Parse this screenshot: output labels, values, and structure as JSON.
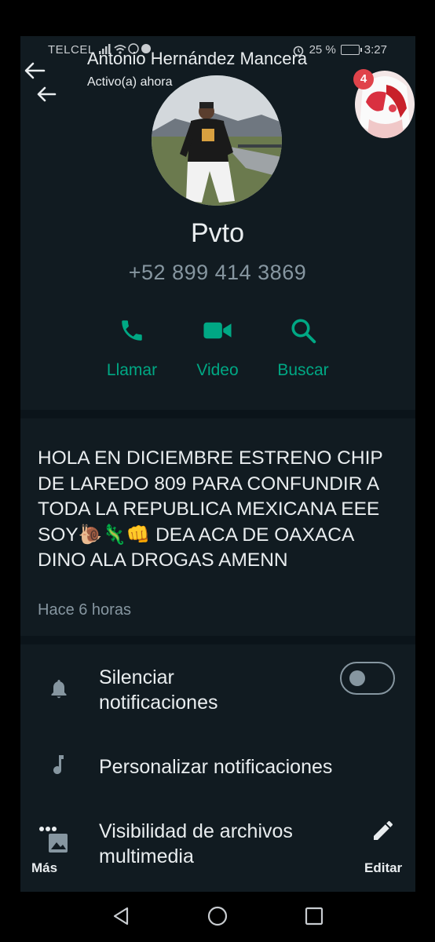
{
  "status_bar": {
    "carrier": "TELCEL",
    "battery": "25 %",
    "time": "3:27"
  },
  "chat_overlay": {
    "name": "Antonio Hernández Mancera",
    "status": "Activo(a) ahora",
    "unread_badge": "4"
  },
  "profile": {
    "name": "Pvto",
    "phone": "+52 899 414 3869"
  },
  "actions": [
    {
      "label": "Llamar",
      "icon": "phone-icon"
    },
    {
      "label": "Video",
      "icon": "video-icon"
    },
    {
      "label": "Buscar",
      "icon": "search-icon"
    }
  ],
  "about": {
    "text": "HOLA EN DICIEMBRE ESTRENO CHIP DE LAREDO 809 PARA CONFUNDIR A TODA LA REPUBLICA MEXICANA EEE SOY🐌🦎👊 DEA ACA DE OAXACA DINO ALA DROGAS AMENN",
    "time": "Hace 6 horas"
  },
  "settings": {
    "mute_label": "Silenciar\nnotificaciones",
    "mute_enabled": false,
    "custom_notifications_label": "Personalizar notificaciones",
    "media_visibility_label": "Visibilidad de archivos\nmultimedia"
  },
  "bottom_actions": {
    "more_label": "Más",
    "edit_label": "Editar"
  },
  "colors": {
    "background": "#111b21",
    "accent": "#00a884",
    "secondary_text": "#8696a0",
    "badge": "#e0434a"
  }
}
